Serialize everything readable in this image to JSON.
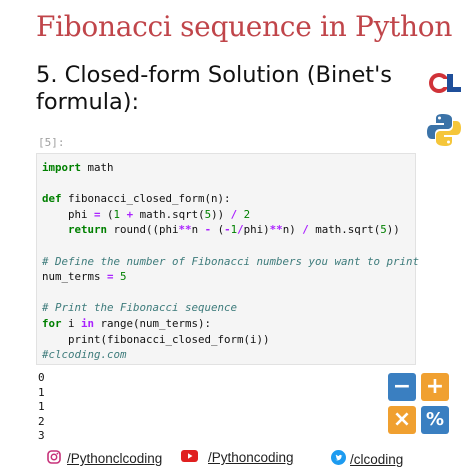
{
  "header": {
    "title": "Fibonacci sequence in Python",
    "heading": "5. Closed-form Solution (Binet's formula):"
  },
  "cell": {
    "prompt": "[5]:",
    "comment_define": "# Define the number of Fibonacci numbers you want to print",
    "comment_print": "# Print the Fibonacci sequence",
    "tag": "#clcoding.com"
  },
  "output": [
    "0",
    "1",
    "1",
    "2",
    "3"
  ],
  "footer": {
    "instagram": "/Pythonclcoding",
    "youtube": "/Pythoncoding",
    "twitter": "/clcoding"
  },
  "icons": {
    "brand_logo": "cl-logo-icon",
    "python_logo": "python-logo-icon",
    "calculator": "calculator-icon"
  },
  "colors": {
    "title": "#c0454a",
    "calc_blue": "#3a7fc1",
    "calc_orange": "#f0a030"
  }
}
